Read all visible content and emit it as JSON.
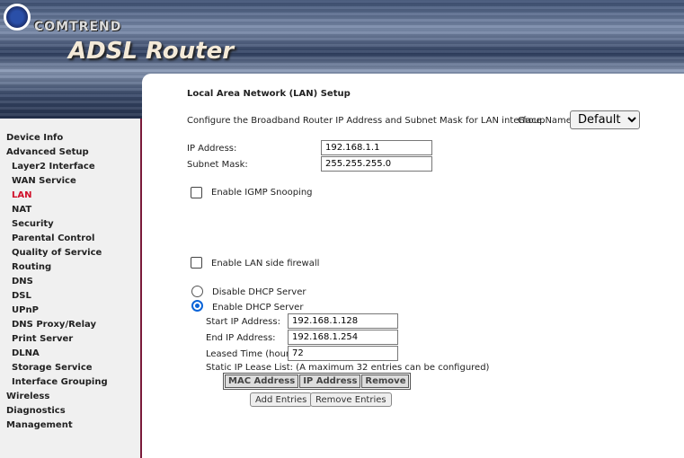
{
  "header": {
    "brand": "COMTREND",
    "product": "ADSL Router"
  },
  "sidebar": {
    "items": [
      {
        "label": "Device Info",
        "level": 0
      },
      {
        "label": "Advanced Setup",
        "level": 0
      },
      {
        "label": "Layer2 Interface",
        "level": 1
      },
      {
        "label": "WAN Service",
        "level": 1
      },
      {
        "label": "LAN",
        "level": 1,
        "active": true
      },
      {
        "label": "NAT",
        "level": 1
      },
      {
        "label": "Security",
        "level": 1
      },
      {
        "label": "Parental Control",
        "level": 1
      },
      {
        "label": "Quality of Service",
        "level": 1
      },
      {
        "label": "Routing",
        "level": 1
      },
      {
        "label": "DNS",
        "level": 1
      },
      {
        "label": "DSL",
        "level": 1
      },
      {
        "label": "UPnP",
        "level": 1
      },
      {
        "label": "DNS Proxy/Relay",
        "level": 1
      },
      {
        "label": "Print Server",
        "level": 1
      },
      {
        "label": "DLNA",
        "level": 1
      },
      {
        "label": "Storage Service",
        "level": 1
      },
      {
        "label": "Interface Grouping",
        "level": 1
      },
      {
        "label": "Wireless",
        "level": 0
      },
      {
        "label": "Diagnostics",
        "level": 0
      },
      {
        "label": "Management",
        "level": 0
      }
    ]
  },
  "main": {
    "title": "Local Area Network (LAN) Setup",
    "description": "Configure the Broadband Router IP Address and Subnet Mask for LAN interface.",
    "group_label": "GroupName",
    "group_value": "Default",
    "ip_label": "IP Address:",
    "ip_value": "192.168.1.1",
    "mask_label": "Subnet Mask:",
    "mask_value": "255.255.255.0",
    "igmp_label": "Enable IGMP Snooping",
    "igmp_checked": false,
    "firewall_label": "Enable LAN side firewall",
    "firewall_checked": false,
    "dhcp_disable_label": "Disable DHCP Server",
    "dhcp_enable_label": "Enable DHCP Server",
    "dhcp_selected": "enable",
    "start_label": "Start IP Address:",
    "start_value": "192.168.1.128",
    "end_label": "End IP Address:",
    "end_value": "192.168.1.254",
    "lease_label": "Leased Time (hour):",
    "lease_value": "72",
    "static_label": "Static IP Lease List: (A maximum 32 entries can be configured)",
    "table_headers": [
      "MAC Address",
      "IP Address",
      "Remove"
    ],
    "add_button": "Add Entries",
    "remove_button": "Remove Entries"
  }
}
